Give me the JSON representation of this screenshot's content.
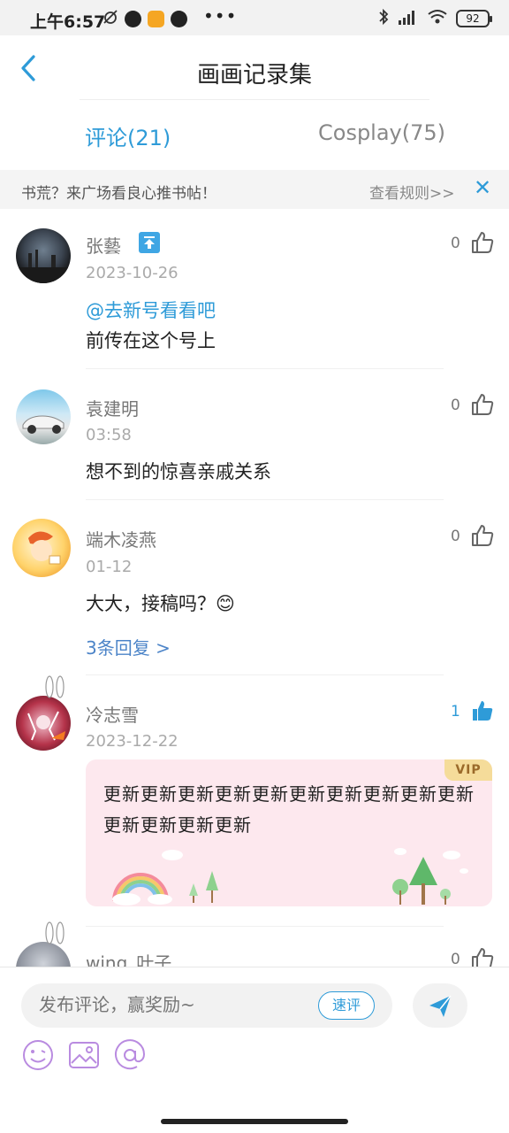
{
  "status_bar": {
    "time": "上午6:57",
    "dots": "•••",
    "battery": "92"
  },
  "header": {
    "title": "画画记录集"
  },
  "tabs": [
    {
      "label": "评论(21)",
      "active": true
    },
    {
      "label": "Cosplay(75)",
      "active": false
    }
  ],
  "notice": {
    "text": "书荒？来广场看良心推书帖！",
    "link": "查看规则>>",
    "close": "✕"
  },
  "comments": [
    {
      "user": "张藝",
      "date": "2023-10-26",
      "mention": "@去新号看看吧",
      "text": "前传在这个号上",
      "likes": "0"
    },
    {
      "user": "袁建明",
      "date": "03:58",
      "text": "想不到的惊喜亲戚关系",
      "likes": "0"
    },
    {
      "user": "端木凌燕",
      "date": "01-12",
      "text": "大大，接稿吗？😊",
      "likes": "0",
      "replies": "3条回复 >"
    },
    {
      "user": "冷志雪",
      "date": "2023-12-22",
      "vip_label": "VIP",
      "text": "更新更新更新更新更新更新更新更新更新更新更新更新更新更新",
      "likes": "1"
    },
    {
      "user": "wing_叶子",
      "likes": "0"
    }
  ],
  "composer": {
    "placeholder": "发布评论，赢奖励~",
    "quick_label": "速评"
  },
  "colors": {
    "accent": "#2e9bd8",
    "vip_bg": "#fde8ee",
    "vip_tag": "#f5dc9a"
  }
}
